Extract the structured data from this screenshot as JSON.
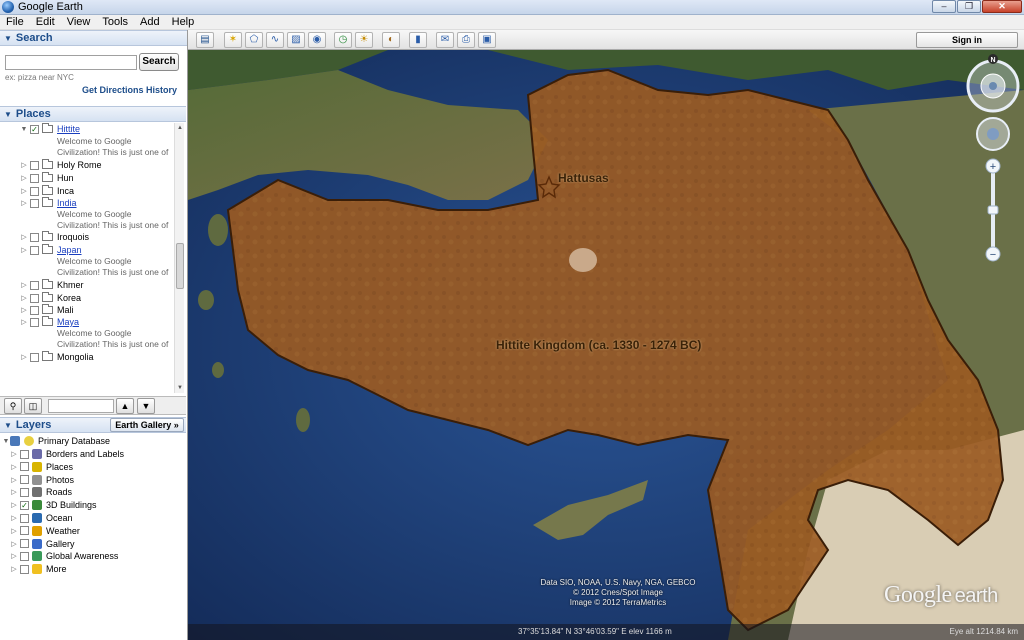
{
  "window": {
    "title": "Google Earth",
    "min": "–",
    "max": "❐",
    "close": "✕"
  },
  "menu": [
    "File",
    "Edit",
    "View",
    "Tools",
    "Add",
    "Help"
  ],
  "search": {
    "header": "Search",
    "placeholder": "",
    "button": "Search",
    "hint": "ex: pizza near NYC",
    "get_directions": "Get Directions",
    "history": "History"
  },
  "places": {
    "header": "Places",
    "items": [
      {
        "label": "Hittite",
        "checked": true,
        "link": true,
        "desc": [
          "Welcome to Google",
          "Civilization! This is just one of"
        ]
      },
      {
        "label": "Holy Rome",
        "checked": false,
        "link": false
      },
      {
        "label": "Hun",
        "checked": false,
        "link": false
      },
      {
        "label": "Inca",
        "checked": false,
        "link": false
      },
      {
        "label": "India",
        "checked": false,
        "link": true,
        "desc": [
          "Welcome to Google",
          "Civilization! This is just one of"
        ]
      },
      {
        "label": "Iroquois",
        "checked": false,
        "link": false
      },
      {
        "label": "Japan",
        "checked": false,
        "link": true,
        "desc": [
          "Welcome to Google",
          "Civilization! This is just one of"
        ]
      },
      {
        "label": "Khmer",
        "checked": false,
        "link": false
      },
      {
        "label": "Korea",
        "checked": false,
        "link": false
      },
      {
        "label": "Mali",
        "checked": false,
        "link": false
      },
      {
        "label": "Maya",
        "checked": false,
        "link": true,
        "desc": [
          "Welcome to Google",
          "Civilization! This is just one of"
        ]
      },
      {
        "label": "Mongolia",
        "checked": false,
        "link": false
      }
    ]
  },
  "layers": {
    "header": "Layers",
    "gallery_button": "Earth Gallery",
    "gallery_arrow": "»",
    "root": "Primary Database",
    "items": [
      {
        "label": "Borders and Labels",
        "checked": false,
        "color": "#6a6aa8"
      },
      {
        "label": "Places",
        "checked": false,
        "color": "#d8b400"
      },
      {
        "label": "Photos",
        "checked": false,
        "color": "#909090"
      },
      {
        "label": "Roads",
        "checked": false,
        "color": "#707070"
      },
      {
        "label": "3D Buildings",
        "checked": true,
        "color": "#3a8a3a"
      },
      {
        "label": "Ocean",
        "checked": false,
        "color": "#2a6ab0"
      },
      {
        "label": "Weather",
        "checked": false,
        "color": "#e0a000"
      },
      {
        "label": "Gallery",
        "checked": false,
        "color": "#3a6ac8"
      },
      {
        "label": "Global Awareness",
        "checked": false,
        "color": "#3a9a5a"
      },
      {
        "label": "More",
        "checked": false,
        "color": "#f0c020"
      }
    ]
  },
  "toolbar": {
    "sign_in": "Sign in"
  },
  "map": {
    "label_capital": "Hattusas",
    "label_kingdom": "Hittite Kingdom (ca. 1330 - 1274 BC)",
    "attribution": [
      "Data SIO, NOAA, U.S. Navy, NGA, GEBCO",
      "© 2012 Cnes/Spot Image",
      "Image © 2012 TerraMetrics"
    ],
    "logo_google": "Google",
    "logo_earth": "earth",
    "coordinates": "37°35'13.84\" N  33°46'03.59\" E  elev  1166 m",
    "eye_alt": "Eye alt  1214.84 km",
    "compass_n": "N",
    "zoom_plus": "+",
    "zoom_minus": "−",
    "colors": {
      "kingdom": "#9a5a22",
      "kingdom_border": "#3a1e08",
      "sea": "#1d3f78"
    }
  }
}
